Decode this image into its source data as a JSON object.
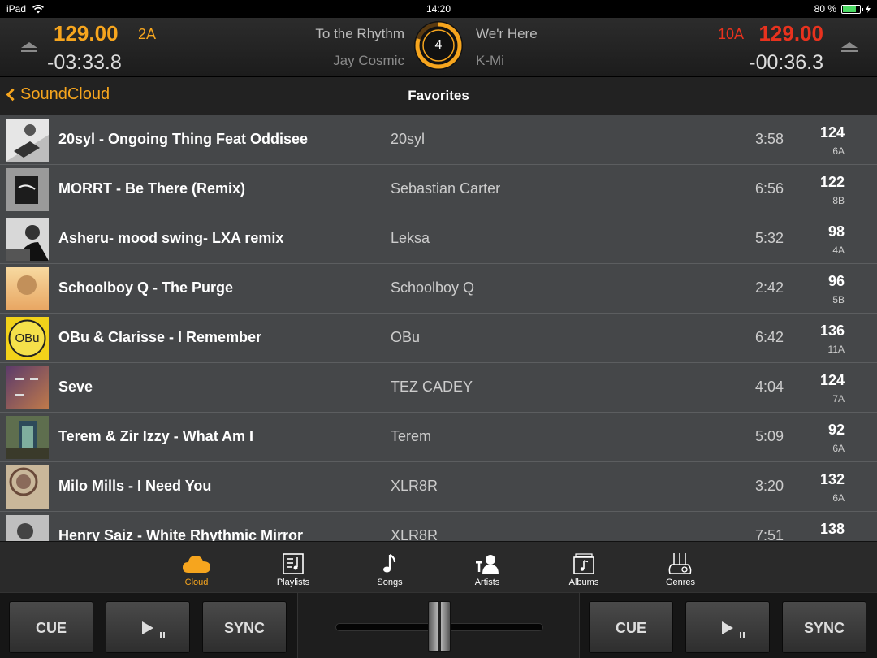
{
  "status": {
    "device": "iPad",
    "time": "14:20",
    "battery": "80 %",
    "battery_level": 0.8
  },
  "deck_a": {
    "bpm": "129.00",
    "key": "2A",
    "time": "-03:33.8",
    "title": "To the Rhythm",
    "artist": "Jay Cosmic"
  },
  "deck_b": {
    "bpm": "129.00",
    "key": "10A",
    "time": "-00:36.3",
    "title": "We'r Here",
    "artist": "K-Mi"
  },
  "center_dial": {
    "value": "4",
    "progress": 0.8,
    "color": "#f6a51e"
  },
  "nav": {
    "back_label": "SoundCloud",
    "title": "Favorites"
  },
  "tracks": [
    {
      "title": "20syl - Ongoing Thing Feat Oddisee",
      "artist": "20syl",
      "duration": "3:58",
      "bpm": "124",
      "key": "6A"
    },
    {
      "title": "MORRT -  Be There (Remix)",
      "artist": "Sebastian Carter",
      "duration": "6:56",
      "bpm": "122",
      "key": "8B"
    },
    {
      "title": "Asheru- mood swing- LXA remix",
      "artist": "Leksa",
      "duration": "5:32",
      "bpm": "98",
      "key": "4A"
    },
    {
      "title": "Schoolboy Q - The Purge",
      "artist": "Schoolboy Q",
      "duration": "2:42",
      "bpm": "96",
      "key": "5B"
    },
    {
      "title": "OBu & Clarisse - I Remember",
      "artist": "OBu",
      "duration": "6:42",
      "bpm": "136",
      "key": "11A"
    },
    {
      "title": "Seve",
      "artist": "TEZ CADEY",
      "duration": "4:04",
      "bpm": "124",
      "key": "7A"
    },
    {
      "title": "Terem & Zir Izzy - What Am I",
      "artist": "Terem",
      "duration": "5:09",
      "bpm": "92",
      "key": "6A"
    },
    {
      "title": "Milo Mills - I Need You",
      "artist": "XLR8R",
      "duration": "3:20",
      "bpm": "132",
      "key": "6A"
    },
    {
      "title": "Henry Saiz - White Rhythmic Mirror",
      "artist": "XLR8R",
      "duration": "7:51",
      "bpm": "138",
      "key": ""
    }
  ],
  "tabs": [
    {
      "label": "Cloud",
      "icon": "cloud-icon",
      "active": true
    },
    {
      "label": "Playlists",
      "icon": "playlist-icon",
      "active": false
    },
    {
      "label": "Songs",
      "icon": "music-note-icon",
      "active": false
    },
    {
      "label": "Artists",
      "icon": "artist-icon",
      "active": false
    },
    {
      "label": "Albums",
      "icon": "album-icon",
      "active": false
    },
    {
      "label": "Genres",
      "icon": "genres-icon",
      "active": false
    }
  ],
  "controls": {
    "cue_label": "CUE",
    "sync_label": "SYNC",
    "crossfader_position": 0.5
  },
  "colors": {
    "accent": "#f6a51e",
    "deck_b": "#e8321e"
  }
}
